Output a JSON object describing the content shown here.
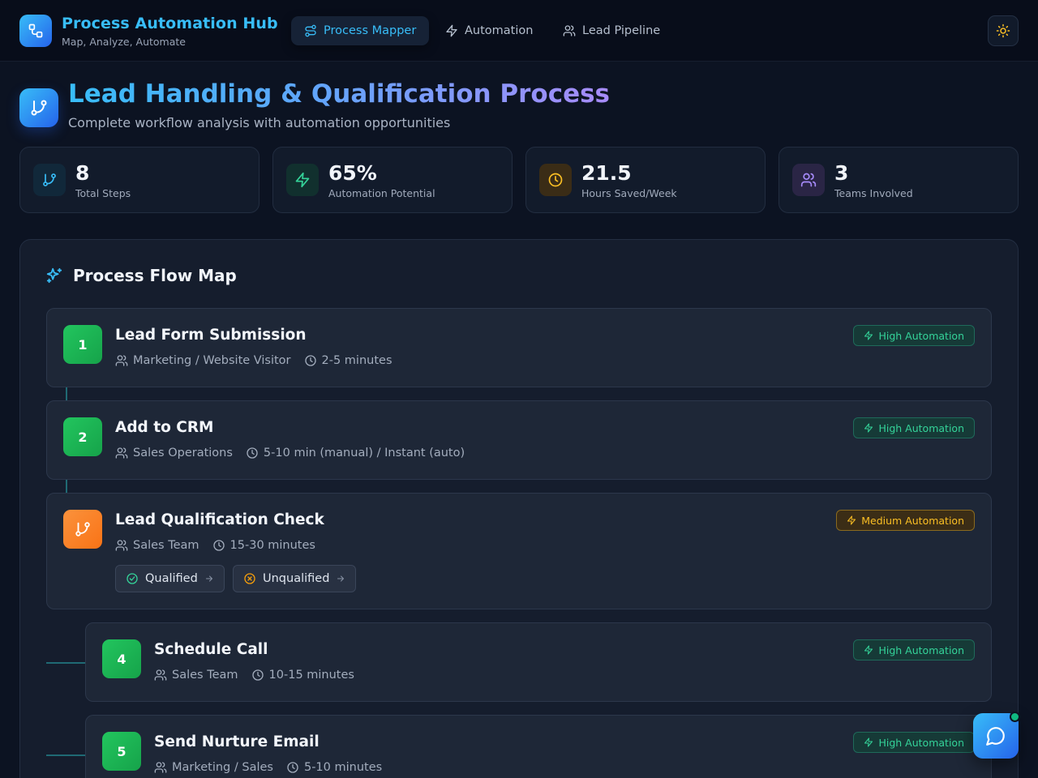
{
  "app": {
    "title": "Process Automation Hub",
    "subtitle": "Map, Analyze, Automate"
  },
  "nav": {
    "tabs": [
      {
        "label": "Process Mapper",
        "icon": "route-icon",
        "active": true
      },
      {
        "label": "Automation",
        "icon": "lightning-icon",
        "active": false
      },
      {
        "label": "Lead Pipeline",
        "icon": "users-icon",
        "active": false
      }
    ],
    "theme_toggle_icon": "sun-icon"
  },
  "page": {
    "title": "Lead Handling & Qualification Process",
    "subtitle": "Complete workflow analysis with automation opportunities"
  },
  "stats": [
    {
      "value": "8",
      "label": "Total Steps",
      "icon": "branch-icon",
      "color": "#38bdf8"
    },
    {
      "value": "65%",
      "label": "Automation Potential",
      "icon": "lightning-icon",
      "color": "#34d399"
    },
    {
      "value": "21.5",
      "label": "Hours Saved/Week",
      "icon": "clock-icon",
      "color": "#fbbf24"
    },
    {
      "value": "3",
      "label": "Teams Involved",
      "icon": "users-icon",
      "color": "#a78bfa"
    }
  ],
  "flow": {
    "title": "Process Flow Map",
    "steps": [
      {
        "number": "1",
        "title": "Lead Form Submission",
        "owner": "Marketing / Website Visitor",
        "duration": "2-5 minutes",
        "automation": "High Automation"
      },
      {
        "number": "2",
        "title": "Add to CRM",
        "owner": "Sales Operations",
        "duration": "5-10 min (manual) / Instant (auto)",
        "automation": "High Automation"
      },
      {
        "number": "",
        "title": "Lead Qualification Check",
        "owner": "Sales Team",
        "duration": "15-30 minutes",
        "automation": "Medium Automation",
        "branches": [
          "Qualified",
          "Unqualified"
        ]
      },
      {
        "number": "4",
        "title": "Schedule Call",
        "owner": "Sales Team",
        "duration": "10-15 minutes",
        "automation": "High Automation"
      },
      {
        "number": "5",
        "title": "Send Nurture Email",
        "owner": "Marketing / Sales",
        "duration": "5-10 minutes",
        "automation": "High Automation"
      }
    ]
  },
  "colors": {
    "accent": "#38bdf8",
    "high_automation": "#34d399",
    "medium_automation": "#fbbf24",
    "background": "#0c1322"
  },
  "chat_button_icon": "chat-bubble-icon"
}
